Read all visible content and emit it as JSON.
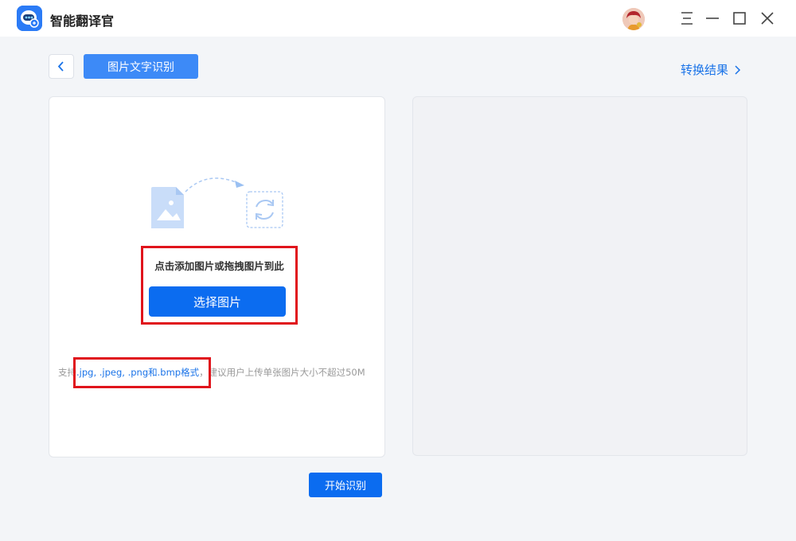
{
  "app": {
    "title": "智能翻译官",
    "logo_icon": "chat-bot-icon",
    "brand_color": "#0b6cf0"
  },
  "window_controls": {
    "menu_icon": "menu-icon",
    "minimize_icon": "minimize-icon",
    "maximize_icon": "maximize-icon",
    "close_icon": "close-icon"
  },
  "header": {
    "back_icon": "chevron-left-icon",
    "page_title": "图片文字识别",
    "result_link": "转换结果"
  },
  "upload": {
    "hint": "点击添加图片或拖拽图片到此",
    "select_button": "选择图片",
    "support_prefix": "支持",
    "support_formats": ".jpg, .jpeg, .png和.bmp格式",
    "support_suffix": "，建议用户上传单张图片大小不超过50M"
  },
  "actions": {
    "start_button": "开始识别"
  },
  "colors": {
    "annotation_red": "#e0141c",
    "tag_blue": "#3d8af7"
  }
}
